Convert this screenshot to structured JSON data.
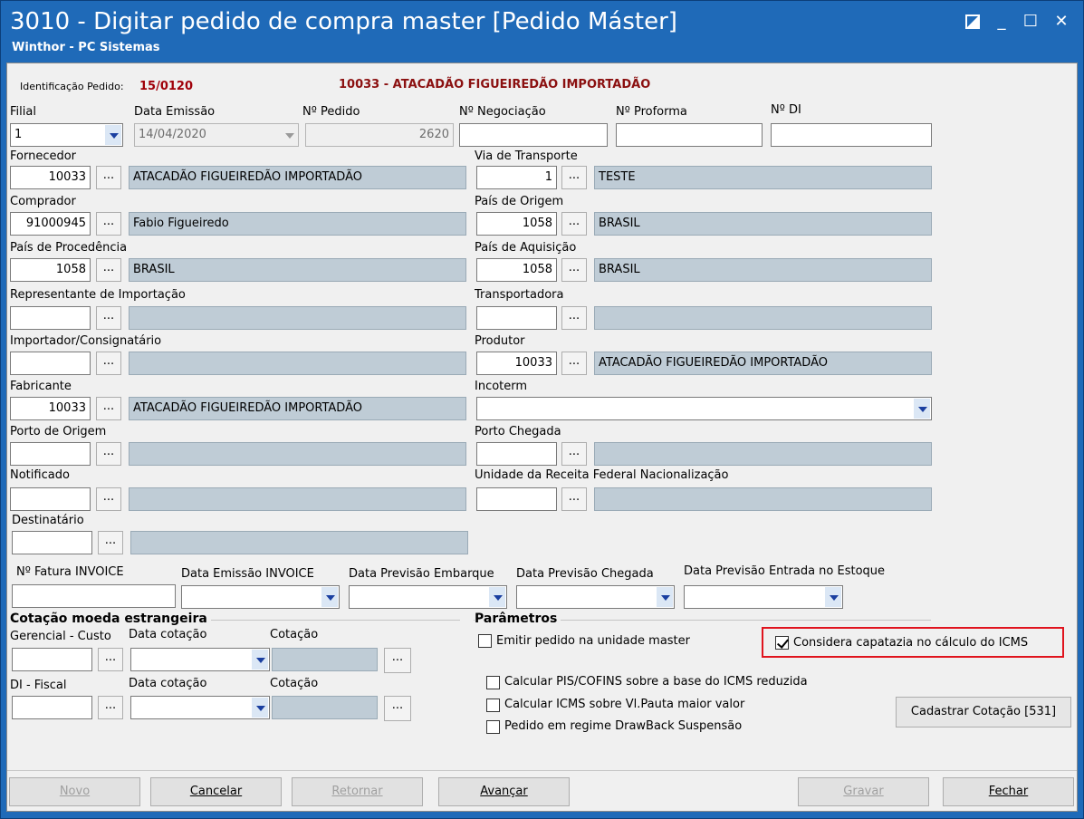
{
  "window": {
    "title": "3010 - Digitar pedido de compra master [Pedido Máster]",
    "subtitle": "Winthor - PC Sistemas",
    "restore_icon": "restore-icon",
    "minimize_glyph": "_",
    "maximize_glyph": "☐",
    "close_glyph": "✕"
  },
  "header": {
    "ident_label": "Identificação Pedido:",
    "ident_value": "15/0120",
    "supplier_heading": "10033 - ATACADÃO FIGUEIREDÃO IMPORTADÃO"
  },
  "fields": {
    "filial": {
      "label": "Filial",
      "value": "1"
    },
    "data_emissao": {
      "label": "Data Emissão",
      "value": "14/04/2020"
    },
    "n_pedido": {
      "label": "Nº Pedido",
      "value": "2620"
    },
    "n_negociacao": {
      "label": "Nº Negociação",
      "value": ""
    },
    "n_proforma": {
      "label": "Nº Proforma",
      "value": ""
    },
    "n_di": {
      "label": "Nº DI",
      "value": ""
    },
    "fornecedor": {
      "label": "Fornecedor",
      "code": "10033",
      "desc": "ATACADÃO FIGUEIREDÃO IMPORTADÃO"
    },
    "via_transporte": {
      "label": "Via de Transporte",
      "code": "1",
      "desc": "TESTE"
    },
    "comprador": {
      "label": "Comprador",
      "code": "91000945",
      "desc": "Fabio Figueiredo"
    },
    "pais_origem": {
      "label": "País de Origem",
      "code": "1058",
      "desc": "BRASIL"
    },
    "pais_procedencia": {
      "label": "País de Procedência",
      "code": "1058",
      "desc": "BRASIL"
    },
    "pais_aquisicao": {
      "label": "País de Aquisição",
      "code": "1058",
      "desc": "BRASIL"
    },
    "representante": {
      "label": "Representante de Importação",
      "code": "",
      "desc": ""
    },
    "transportadora": {
      "label": "Transportadora",
      "code": "",
      "desc": ""
    },
    "importador": {
      "label": "Importador/Consignatário",
      "code": "",
      "desc": ""
    },
    "produtor": {
      "label": "Produtor",
      "code": "10033",
      "desc": "ATACADÃO FIGUEIREDÃO IMPORTADÃO"
    },
    "fabricante": {
      "label": "Fabricante",
      "code": "10033",
      "desc": "ATACADÃO FIGUEIREDÃO IMPORTADÃO"
    },
    "incoterm": {
      "label": "Incoterm",
      "value": ""
    },
    "porto_origem": {
      "label": "Porto de Origem",
      "code": "",
      "desc": ""
    },
    "porto_chegada": {
      "label": "Porto Chegada",
      "code": "",
      "desc": ""
    },
    "notificado": {
      "label": "Notificado",
      "code": "",
      "desc": ""
    },
    "unidade_receita": {
      "label": "Unidade da Receita Federal Nacionalização",
      "code": "",
      "desc": ""
    },
    "destinatario": {
      "label": "Destinatário",
      "code": "",
      "desc": ""
    },
    "n_fatura_invoice": {
      "label": "Nº Fatura INVOICE",
      "value": ""
    },
    "data_emissao_invoice": {
      "label": "Data Emissão INVOICE",
      "value": ""
    },
    "data_prev_embarque": {
      "label": "Data Previsão Embarque",
      "value": ""
    },
    "data_prev_chegada": {
      "label": "Data Previsão Chegada",
      "value": ""
    },
    "data_prev_entrada": {
      "label": "Data Previsão Entrada no Estoque",
      "value": ""
    },
    "ellipsis": "..."
  },
  "cotacao": {
    "title": "Cotação moeda estrangeira",
    "gerencial_label": "Gerencial - Custo",
    "data_cotacao_label": "Data cotação",
    "cotacao_label": "Cotação",
    "di_fiscal_label": "DI - Fiscal"
  },
  "parametros": {
    "title": "Parâmetros",
    "emitir_master": {
      "label": "Emitir pedido na unidade master",
      "checked": false
    },
    "capatazia": {
      "label": "Considera capatazia no cálculo do ICMS",
      "checked": true
    },
    "pis_cofins": {
      "label": "Calcular PIS/COFINS sobre a base do ICMS reduzida",
      "checked": false
    },
    "icms_pauta": {
      "label": "Calcular ICMS sobre Vl.Pauta maior valor",
      "checked": false
    },
    "drawback": {
      "label": "Pedido em regime DrawBack Suspensão",
      "checked": false
    },
    "cadastrar_cotacao": "Cadastrar Cotação [531]",
    "highlight_color": "#e0141e"
  },
  "buttons": {
    "novo": "Novo",
    "cancelar": "Cancelar",
    "retornar": "Retornar",
    "avancar": "Avançar",
    "gravar": "Gravar",
    "fechar": "Fechar"
  },
  "colors": {
    "titlebar": "#1f6ab8",
    "readonly_field": "#bfccd6",
    "supplier_heading": "#8b1010"
  }
}
